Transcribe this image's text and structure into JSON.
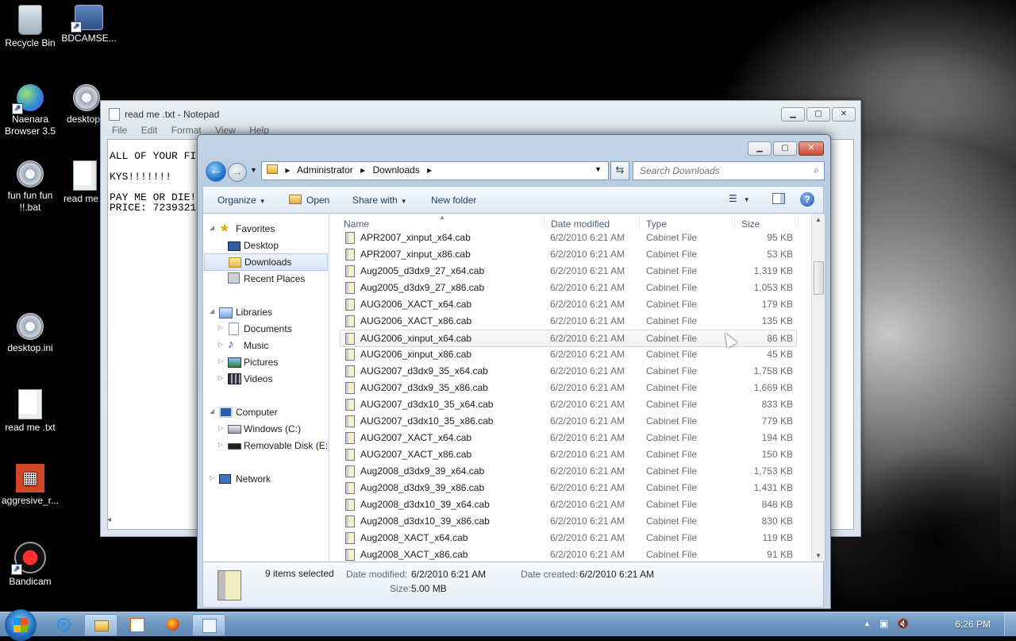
{
  "desktop": {
    "icons": [
      {
        "label": "Recycle Bin",
        "icon": "recycle-bin-icon"
      },
      {
        "label": "BDCAMSE...",
        "icon": "bdcam-setup-icon"
      },
      {
        "label": "Naenara Browser 3.5",
        "icon": "naenara-browser-icon"
      },
      {
        "label": "desktop",
        "icon": "settings-file-icon"
      },
      {
        "label": "fun fun fun !!.bat",
        "icon": "batch-file-icon"
      },
      {
        "label": "read me",
        "icon": "text-file-icon"
      },
      {
        "label": "desktop.ini",
        "icon": "settings-file-icon"
      },
      {
        "label": "read me .txt",
        "icon": "text-file-icon"
      },
      {
        "label": "aggresive_r...",
        "icon": "office-icon"
      },
      {
        "label": "Bandicam",
        "icon": "bandicam-icon"
      }
    ]
  },
  "notepad": {
    "title": "read me .txt - Notepad",
    "menu": [
      "File",
      "Edit",
      "Format",
      "View",
      "Help"
    ],
    "content": "ALL OF YOUR FI\n\nKYS!!!!!!!\n\nPAY ME OR DIE!\nPRICE: 7239321"
  },
  "explorer": {
    "breadcrumb": [
      "Administrator",
      "Downloads"
    ],
    "search_placeholder": "Search Downloads",
    "toolbar": {
      "organize": "Organize",
      "open": "Open",
      "share_with": "Share with",
      "new_folder": "New folder"
    },
    "nav": {
      "favorites": "Favorites",
      "desktop": "Desktop",
      "downloads": "Downloads",
      "recent_places": "Recent Places",
      "libraries": "Libraries",
      "documents": "Documents",
      "music": "Music",
      "pictures": "Pictures",
      "videos": "Videos",
      "computer": "Computer",
      "windows_c": "Windows (C:)",
      "removable_e": "Removable Disk (E:)",
      "network": "Network"
    },
    "columns": {
      "name": "Name",
      "date": "Date modified",
      "type": "Type",
      "size": "Size"
    },
    "files": [
      {
        "name": "APR2007_xinput_x64.cab",
        "date": "6/2/2010 6:21 AM",
        "type": "Cabinet File",
        "size": "95 KB"
      },
      {
        "name": "APR2007_xinput_x86.cab",
        "date": "6/2/2010 6:21 AM",
        "type": "Cabinet File",
        "size": "53 KB"
      },
      {
        "name": "Aug2005_d3dx9_27_x64.cab",
        "date": "6/2/2010 6:21 AM",
        "type": "Cabinet File",
        "size": "1,319 KB"
      },
      {
        "name": "Aug2005_d3dx9_27_x86.cab",
        "date": "6/2/2010 6:21 AM",
        "type": "Cabinet File",
        "size": "1,053 KB"
      },
      {
        "name": "AUG2006_XACT_x64.cab",
        "date": "6/2/2010 6:21 AM",
        "type": "Cabinet File",
        "size": "179 KB"
      },
      {
        "name": "AUG2006_XACT_x86.cab",
        "date": "6/2/2010 6:21 AM",
        "type": "Cabinet File",
        "size": "135 KB"
      },
      {
        "name": "AUG2006_xinput_x64.cab",
        "date": "6/2/2010 6:21 AM",
        "type": "Cabinet File",
        "size": "86 KB"
      },
      {
        "name": "AUG2006_xinput_x86.cab",
        "date": "6/2/2010 6:21 AM",
        "type": "Cabinet File",
        "size": "45 KB"
      },
      {
        "name": "AUG2007_d3dx9_35_x64.cab",
        "date": "6/2/2010 6:21 AM",
        "type": "Cabinet File",
        "size": "1,758 KB"
      },
      {
        "name": "AUG2007_d3dx9_35_x86.cab",
        "date": "6/2/2010 6:21 AM",
        "type": "Cabinet File",
        "size": "1,669 KB"
      },
      {
        "name": "AUG2007_d3dx10_35_x64.cab",
        "date": "6/2/2010 6:21 AM",
        "type": "Cabinet File",
        "size": "833 KB"
      },
      {
        "name": "AUG2007_d3dx10_35_x86.cab",
        "date": "6/2/2010 6:21 AM",
        "type": "Cabinet File",
        "size": "779 KB"
      },
      {
        "name": "AUG2007_XACT_x64.cab",
        "date": "6/2/2010 6:21 AM",
        "type": "Cabinet File",
        "size": "194 KB"
      },
      {
        "name": "AUG2007_XACT_x86.cab",
        "date": "6/2/2010 6:21 AM",
        "type": "Cabinet File",
        "size": "150 KB"
      },
      {
        "name": "Aug2008_d3dx9_39_x64.cab",
        "date": "6/2/2010 6:21 AM",
        "type": "Cabinet File",
        "size": "1,753 KB"
      },
      {
        "name": "Aug2008_d3dx9_39_x86.cab",
        "date": "6/2/2010 6:21 AM",
        "type": "Cabinet File",
        "size": "1,431 KB"
      },
      {
        "name": "Aug2008_d3dx10_39_x64.cab",
        "date": "6/2/2010 6:21 AM",
        "type": "Cabinet File",
        "size": "848 KB"
      },
      {
        "name": "Aug2008_d3dx10_39_x86.cab",
        "date": "6/2/2010 6:21 AM",
        "type": "Cabinet File",
        "size": "830 KB"
      },
      {
        "name": "Aug2008_XACT_x64.cab",
        "date": "6/2/2010 6:21 AM",
        "type": "Cabinet File",
        "size": "119 KB"
      },
      {
        "name": "Aug2008_XACT_x86.cab",
        "date": "6/2/2010 6:21 AM",
        "type": "Cabinet File",
        "size": "91 KB"
      }
    ],
    "details": {
      "selected": "9 items selected",
      "date_modified_label": "Date modified:",
      "date_modified_value": "6/2/2010 6:21 AM",
      "date_created_label": "Date created:",
      "date_created_value": "6/2/2010 6:21 AM",
      "size_label": "Size:",
      "size_value": "5.00 MB"
    }
  },
  "taskbar": {
    "time": "6:26 PM",
    "buttons": [
      "internet-explorer-icon",
      "explorer-folder-icon",
      "media-player-icon",
      "firefox-icon",
      "notepad-icon"
    ]
  }
}
